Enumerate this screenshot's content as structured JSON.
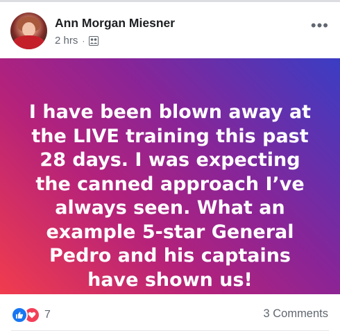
{
  "post": {
    "author": "Ann Morgan Miesner",
    "time": "2 hrs",
    "separator": "·",
    "audience_icon": "friends-icon",
    "more_label": "•••",
    "text": "I have been blown away at the LIVE training this past 28 days. I was expecting the canned approach I’ve always seen. What an example 5-star General Pedro and his captains have shown us!",
    "background_colors": [
      "#f13c4d",
      "#b5227a",
      "#8b2496",
      "#3a3dc4"
    ]
  },
  "footer": {
    "reaction_count": "7",
    "reaction_icons": [
      "like-icon",
      "love-icon"
    ],
    "comments_label": "3 Comments"
  }
}
